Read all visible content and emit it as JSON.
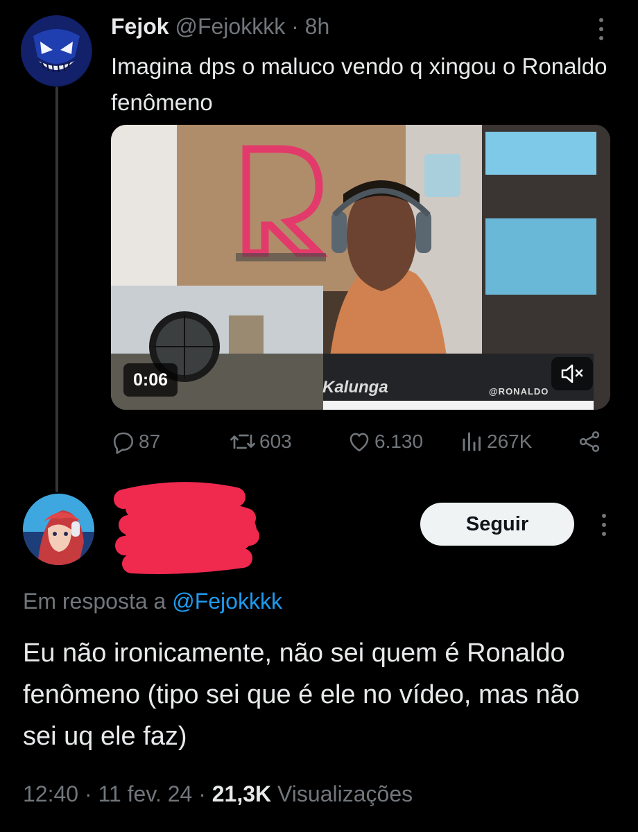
{
  "tweet": {
    "author_name": "Fejok",
    "author_handle": "@Fejokkkk",
    "separator": "·",
    "time": "8h",
    "text": "Imagina dps o maluco vendo q xingou o Ronaldo fenômeno",
    "video": {
      "duration": "0:06",
      "overlay_watermark": "@RONALDO",
      "sponsor_text": "Kalunga"
    },
    "stats": {
      "replies": "87",
      "retweets": "603",
      "likes": "6.130",
      "views": "267K"
    },
    "icons": [
      "reply-icon",
      "retweet-icon",
      "like-icon",
      "views-icon",
      "share-icon",
      "more-icon",
      "mute-icon"
    ]
  },
  "reply": {
    "follow_label": "Seguir",
    "reply_to_prefix": "Em resposta a",
    "reply_to_handle": "@Fejokkkk",
    "text": "Eu não ironicamente, não sei quem é Ronaldo fenômeno (tipo sei que é ele no vídeo, mas não sei uq ele faz)",
    "timestamp": "12:40",
    "separator": "·",
    "date": "11 fev. 24",
    "views_count": "21,3K",
    "views_label": "Visualizações"
  },
  "colors": {
    "background": "#000000",
    "text_primary": "#e7e9ea",
    "text_secondary": "#71767b",
    "link": "#1d9bf0",
    "redaction": "#f0294f"
  }
}
